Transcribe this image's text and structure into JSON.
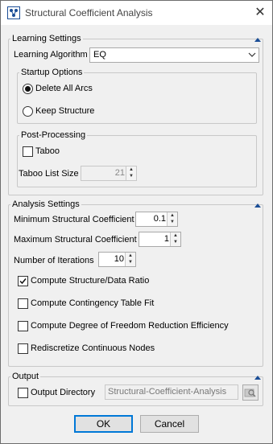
{
  "window": {
    "title": "Structural Coefficient Analysis",
    "close_symbol": "✕"
  },
  "learning": {
    "legend": "Learning Settings",
    "algorithm_label": "Learning Algorithm",
    "algorithm_value": "EQ",
    "startup": {
      "legend": "Startup Options",
      "delete_all_arcs": "Delete All Arcs",
      "keep_structure": "Keep Structure",
      "selected": "Delete All Arcs"
    },
    "post": {
      "legend": "Post-Processing",
      "taboo_label": "Taboo",
      "taboo_checked": false,
      "taboo_list_size_label": "Taboo List Size",
      "taboo_list_size_value": "21"
    }
  },
  "analysis": {
    "legend": "Analysis Settings",
    "min_label": "Minimum Structural Coefficient",
    "min_value": "0.1",
    "max_label": "Maximum Structural Coefficient",
    "max_value": "1",
    "iterations_label": "Number of Iterations",
    "iterations_value": "10",
    "compute_ratio": "Compute Structure/Data Ratio",
    "compute_ratio_checked": true,
    "compute_contingency": "Compute Contingency Table Fit",
    "compute_contingency_checked": false,
    "compute_dof": "Compute Degree of Freedom Reduction Efficiency",
    "compute_dof_checked": false,
    "rediscretize": "Rediscretize Continuous Nodes",
    "rediscretize_checked": false
  },
  "output": {
    "legend": "Output",
    "directory_label": "Output Directory",
    "directory_checked": false,
    "directory_value": "Structural-Coefficient-Analysis"
  },
  "buttons": {
    "ok": "OK",
    "cancel": "Cancel"
  },
  "icons": {
    "app": "bayesian-network-icon",
    "close": "close-icon",
    "collapse": "collapse-up-icon",
    "dropdown": "chevron-down-icon",
    "browse": "folder-search-icon",
    "checkmark": "check-icon"
  },
  "colors": {
    "window_bg": "#f0f0f0",
    "default_button_border": "#0078d7",
    "app_icon": "#1a4d96"
  }
}
